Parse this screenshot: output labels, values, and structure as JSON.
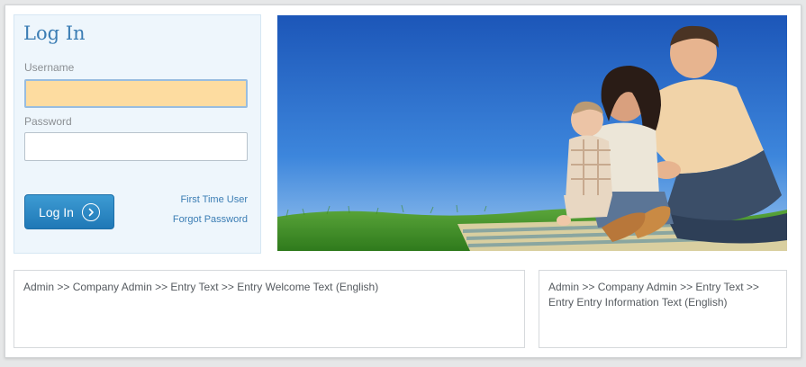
{
  "login": {
    "title": "Log In",
    "username_label": "Username",
    "username_value": "",
    "password_label": "Password",
    "password_value": "",
    "button_label": "Log In",
    "first_time_link": "First Time User",
    "forgot_link": "Forgot Password"
  },
  "hero": {
    "icon": "family-photo"
  },
  "welcome_box": {
    "text": "Admin >> Company Admin >> Entry Text >> Entry Welcome Text (English)"
  },
  "info_box": {
    "text": "Admin >> Company Admin >> Entry Text >> Entry Entry Information Text (English)"
  },
  "colors": {
    "accent": "#3b7db4",
    "button": "#2a8ac7",
    "username_fill": "#fddca0"
  }
}
